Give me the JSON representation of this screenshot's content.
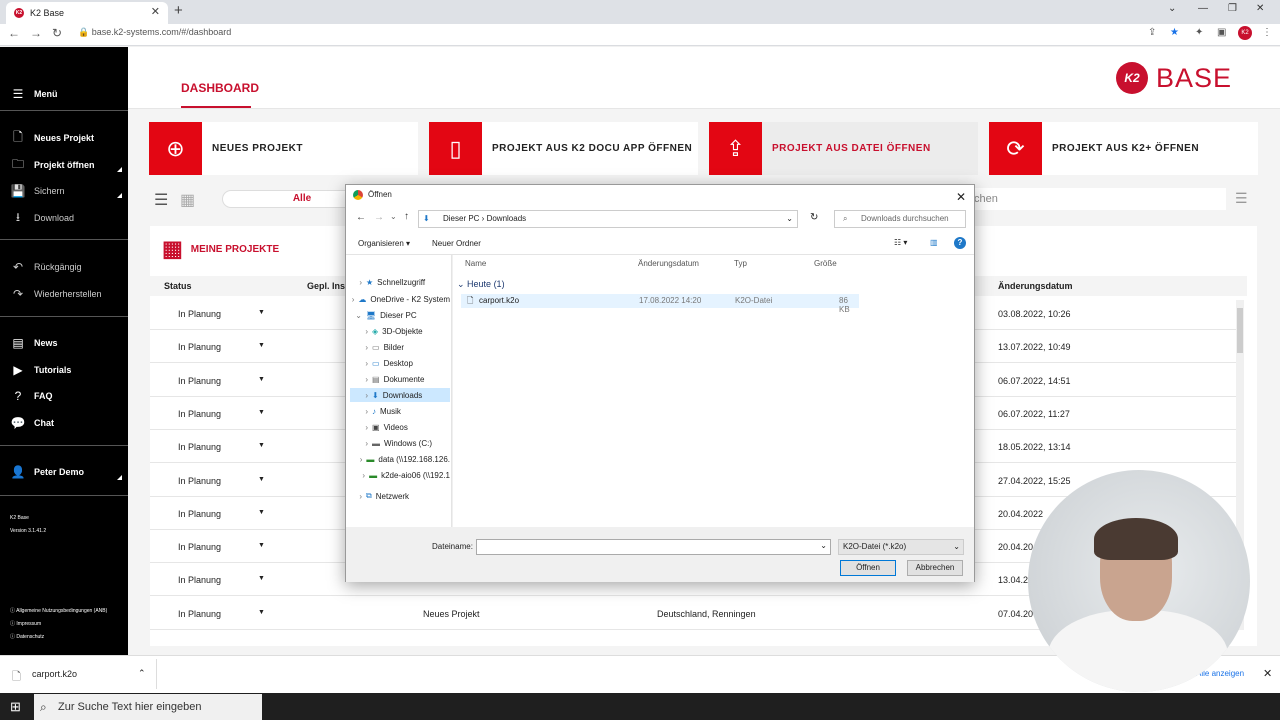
{
  "browser": {
    "tab_title": "K2 Base",
    "url": "base.k2-systems.com/#/dashboard"
  },
  "sidebar": {
    "menu": "Menü",
    "items": [
      "Neues Projekt",
      "Projekt öffnen",
      "Sichern",
      "Download"
    ],
    "undo": "Rückgängig",
    "redo": "Wiederherstellen",
    "info": [
      "News",
      "Tutorials",
      "FAQ",
      "Chat"
    ],
    "user": "Peter Demo",
    "app": "K2 Base",
    "version": "Version 3.1.41.2",
    "footer": [
      "Allgemeine Nutzungsbedingungen (ANB)",
      "Impressum",
      "Datenschutz"
    ]
  },
  "header": {
    "tab": "DASHBOARD",
    "logo_mark": "K2",
    "logo_text": "BASE"
  },
  "cards": [
    "NEUES PROJEKT",
    "PROJEKT AUS K2 DOCU APP ÖFFNEN",
    "PROJEKT AUS DATEI ÖFFNEN",
    "PROJEKT AUS K2+ ÖFFNEN"
  ],
  "toolbar": {
    "filter": "Alle",
    "search": "chen"
  },
  "projects": {
    "title": "MEINE PROJEKTE",
    "col_status": "Status",
    "col_planned": "Gepl. Inst",
    "col_changed": "Änderungsdatum",
    "rows": [
      {
        "status": "In Planung",
        "name": "",
        "loc": "",
        "date": "03.08.2022, 10:26"
      },
      {
        "status": "In Planung",
        "name": "",
        "loc": "",
        "date": "13.07.2022, 10:49"
      },
      {
        "status": "In Planung",
        "name": "",
        "loc": "",
        "date": "06.07.2022, 14:51"
      },
      {
        "status": "In Planung",
        "name": "",
        "loc": "",
        "date": "06.07.2022, 11:27"
      },
      {
        "status": "In Planung",
        "name": "",
        "loc": "",
        "date": "18.05.2022, 13:14"
      },
      {
        "status": "In Planung",
        "name": "",
        "loc": "",
        "date": "27.04.2022, 15:25"
      },
      {
        "status": "In Planung",
        "name": "",
        "loc": "",
        "date": "20.04.2022"
      },
      {
        "status": "In Planung",
        "name": "",
        "loc": "",
        "date": "20.04.20"
      },
      {
        "status": "In Planung",
        "name": "",
        "loc": "",
        "date": "13.04.20"
      },
      {
        "status": "In Planung",
        "name": "Neues Projekt",
        "loc": "Deutschland, Renningen",
        "date": "07.04.20"
      }
    ]
  },
  "dialog": {
    "title": "Öffnen",
    "path": [
      "Dieser PC",
      "Downloads"
    ],
    "search": "Downloads durchsuchen",
    "organize": "Organisieren",
    "new_folder": "Neuer Ordner",
    "tree": [
      "Schnellzugriff",
      "OneDrive - K2 System",
      "Dieser PC",
      "3D-Objekte",
      "Bilder",
      "Desktop",
      "Dokumente",
      "Downloads",
      "Musik",
      "Videos",
      "Windows (C:)",
      "data (\\\\192.168.126.",
      "k2de-aio06 (\\\\192.1",
      "Netzwerk"
    ],
    "cols": [
      "Name",
      "Änderungsdatum",
      "Typ",
      "Größe"
    ],
    "group": "Heute (1)",
    "file": {
      "name": "carport.k2o",
      "date": "17.08.2022 14:20",
      "type": "K2O-Datei",
      "size": "86 KB"
    },
    "filename_label": "Dateiname:",
    "filetype": "K2O-Datei (*.k2o)",
    "open": "Öffnen",
    "cancel": "Abbrechen"
  },
  "downloads": {
    "file": "carport.k2o",
    "show_all": "Alle anzeigen"
  },
  "taskbar": {
    "search": "Zur Suche Text hier eingeben"
  },
  "colors": {
    "brand": "#c8102e",
    "accent": "#e30613"
  }
}
